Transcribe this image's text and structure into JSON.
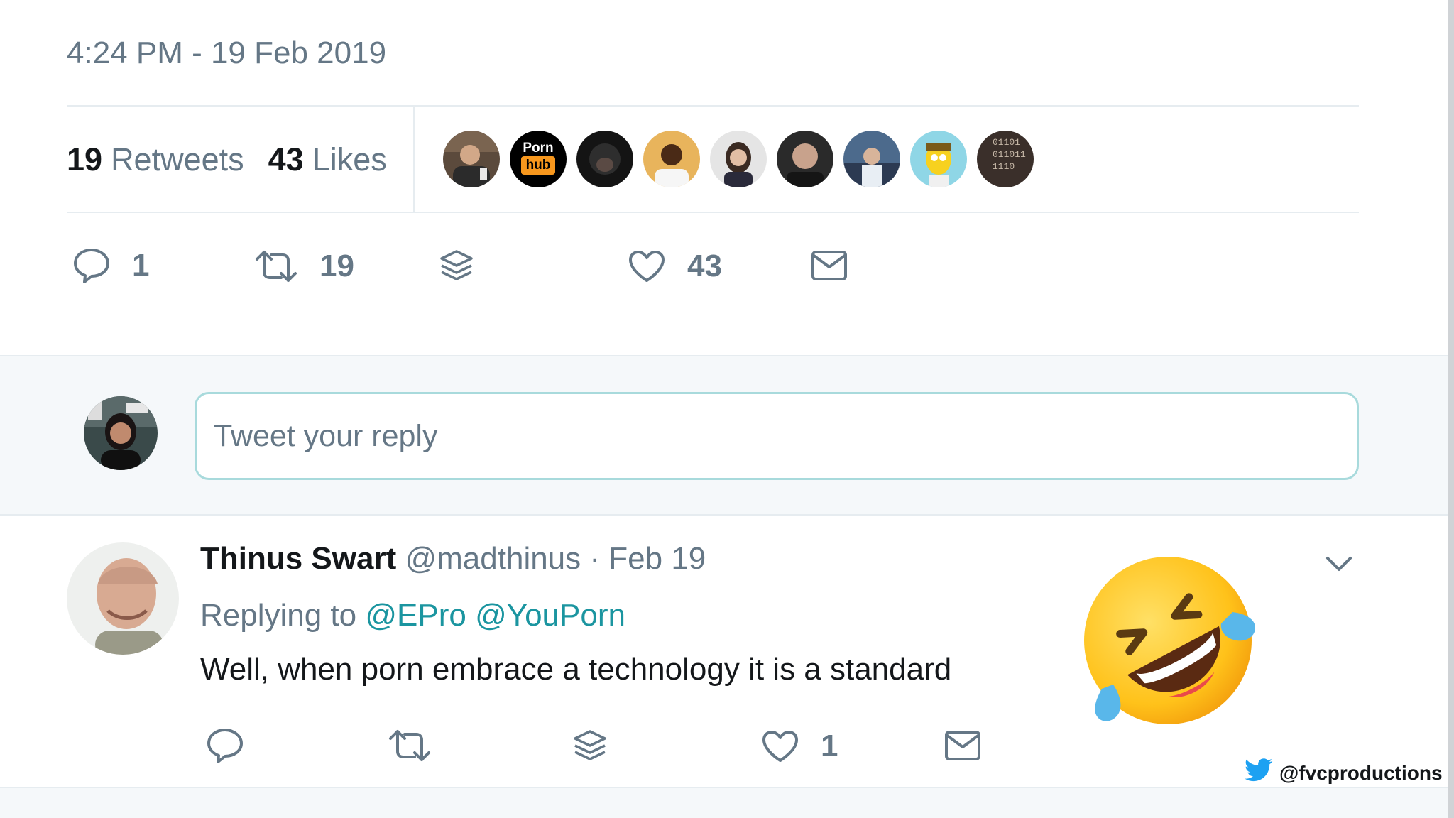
{
  "tweet": {
    "timestamp": "4:24 PM - 19 Feb 2019",
    "retweets_count": "19",
    "retweets_label": "Retweets",
    "likes_count": "43",
    "likes_label": "Likes",
    "liker_avatars": [
      {
        "name": "liker-avatar-1"
      },
      {
        "name": "liker-avatar-pornhub",
        "line1": "Porn",
        "line2": "hub"
      },
      {
        "name": "liker-avatar-3"
      },
      {
        "name": "liker-avatar-4"
      },
      {
        "name": "liker-avatar-5"
      },
      {
        "name": "liker-avatar-6"
      },
      {
        "name": "liker-avatar-7"
      },
      {
        "name": "liker-avatar-8"
      },
      {
        "name": "liker-avatar-9",
        "line1": "01101",
        "line2": "011011",
        "line3": "1110"
      }
    ],
    "actions": {
      "reply_count": "1",
      "retweet_count": "19",
      "like_count": "43"
    }
  },
  "reply_box": {
    "placeholder": "Tweet your reply"
  },
  "reply_tweet": {
    "name": "Thinus Swart",
    "handle": "@madthinus",
    "separator": "·",
    "date": "Feb 19",
    "replying_prefix": "Replying to",
    "mention_1": "@EPro",
    "mention_2": "@YouPorn",
    "text": "Well, when porn embrace a technology it is a standard",
    "like_count": "1"
  },
  "watermark": {
    "handle": "@fvcproductions"
  },
  "colors": {
    "muted": "#657786",
    "accent": "#1b95a0",
    "border": "#e6ecf0",
    "twitter_blue": "#1da1f2"
  }
}
